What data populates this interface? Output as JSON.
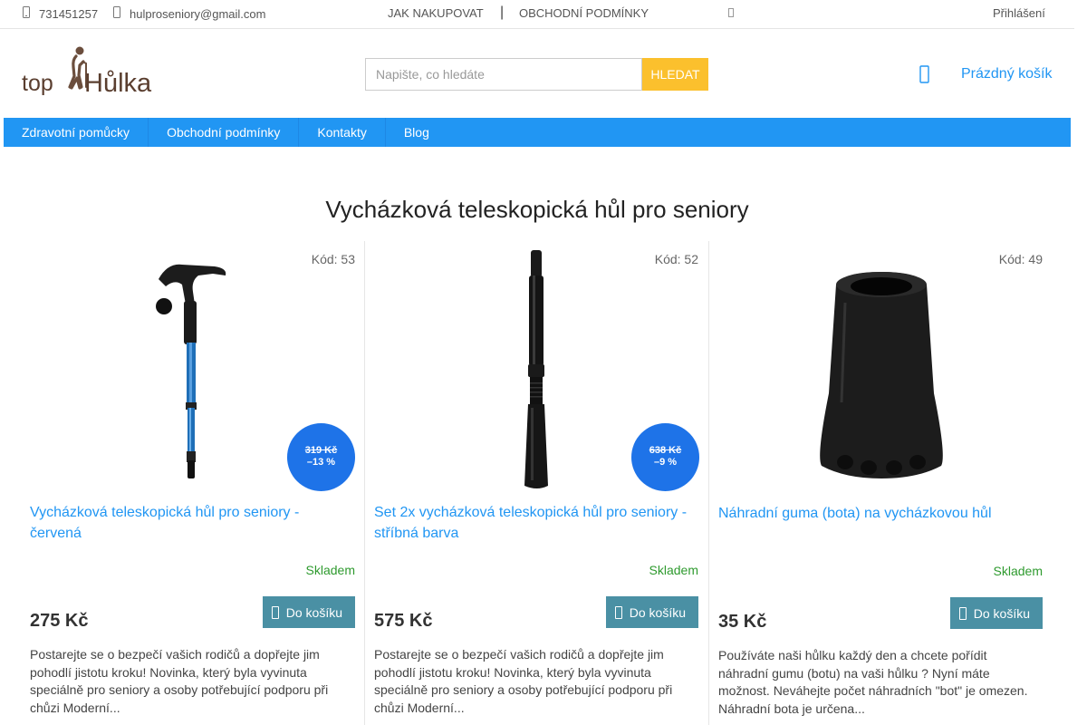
{
  "topbar": {
    "phone": "731451257",
    "email": "hulproseniory@gmail.com",
    "link_how_to_buy": "JAK NAKUPOVAT",
    "separator": "|",
    "link_terms": "OBCHODNÍ PODMÍNKY",
    "login": "Přihlášení"
  },
  "header": {
    "logo_text_top": "top",
    "logo_text_hulka": "Hůlka",
    "search_placeholder": "Napište, co hledáte",
    "search_button": "HLEDAT",
    "cart_label": "Prázdný košík"
  },
  "nav": [
    {
      "label": "Zdravotní pomůcky"
    },
    {
      "label": "Obchodní podmínky"
    },
    {
      "label": "Kontakty"
    },
    {
      "label": "Blog"
    }
  ],
  "page_title": "Vycházková teleskopická hůl pro seniory",
  "products": [
    {
      "code": "Kód: 53",
      "name": "Vycházková teleskopická hůl pro seniory - červená",
      "stock": "Skladem",
      "price": "275 Kč",
      "button": "Do košíku",
      "old_price": "319 Kč",
      "discount": "–13 %",
      "description": "Postarejte se o bezpečí vašich rodičů a dopřejte jim pohodlí jistotu kroku! Novinka, který byla vyvinuta speciálně pro seniory a osoby potřebující podporu při chůzi Moderní..."
    },
    {
      "code": "Kód: 52",
      "name": "Set 2x vycházková teleskopická hůl pro seniory - stříbná barva",
      "stock": "Skladem",
      "price": "575 Kč",
      "button": "Do košíku",
      "old_price": "638 Kč",
      "discount": "–9 %",
      "description": "Postarejte se o bezpečí vašich rodičů a dopřejte jim pohodlí jistotu kroku! Novinka, který byla vyvinuta speciálně pro seniory a osoby potřebující podporu při chůzi Moderní..."
    },
    {
      "code": "Kód: 49",
      "name": "Náhradní guma (bota) na vycházkovou hůl",
      "stock": "Skladem",
      "price": "35 Kč",
      "button": "Do košíku",
      "description": "Používáte naši hůlku každý den a chcete pořídit náhradní gumu (botu) na vaši hůlku ? Nyní máte možnost. Neváhejte počet náhradních \"bot\" je omezen. Náhradní bota je určena..."
    }
  ],
  "colors": {
    "accent": "#2196f3",
    "search_button": "#fbc02d",
    "cart_button": "#4a90a4",
    "badge": "#1e73e8",
    "stock": "#2e9a2e"
  }
}
